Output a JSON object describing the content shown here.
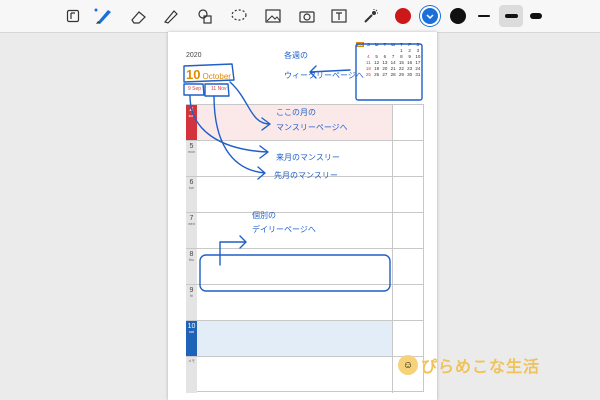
{
  "toolbar": {
    "tools": [
      {
        "name": "page-nav-icon"
      },
      {
        "name": "pen-icon"
      },
      {
        "name": "eraser-icon"
      },
      {
        "name": "highlighter-icon"
      },
      {
        "name": "shapes-icon"
      },
      {
        "name": "lasso-icon"
      },
      {
        "name": "image-icon"
      },
      {
        "name": "camera-icon"
      },
      {
        "name": "text-icon"
      },
      {
        "name": "laser-pointer-icon"
      }
    ],
    "colors": [
      "#cc1818",
      "#1a6fd8",
      "#111111"
    ],
    "selected_color": "#1a6fd8",
    "stroke_widths": [
      "thin",
      "medium",
      "thick"
    ],
    "selected_stroke": "medium"
  },
  "planner": {
    "year": "2020",
    "day": "10",
    "month": "October",
    "prev_tab": "9 Sep",
    "next_tab": "11 Nov",
    "mini_calendar": {
      "badge": "10",
      "weekdays": [
        "S",
        "M",
        "T",
        "W",
        "T",
        "F",
        "S"
      ],
      "rows": [
        [
          "",
          "",
          "",
          "",
          "1",
          "2",
          "3"
        ],
        [
          "4",
          "5",
          "6",
          "7",
          "8",
          "9",
          "10"
        ],
        [
          "11",
          "12",
          "13",
          "14",
          "15",
          "16",
          "17"
        ],
        [
          "18",
          "19",
          "20",
          "21",
          "22",
          "23",
          "24"
        ],
        [
          "25",
          "26",
          "27",
          "28",
          "29",
          "30",
          "31"
        ]
      ]
    },
    "days": [
      {
        "num": "4",
        "dow": "sun"
      },
      {
        "num": "5",
        "dow": "mon"
      },
      {
        "num": "6",
        "dow": "tue"
      },
      {
        "num": "7",
        "dow": "wed"
      },
      {
        "num": "8",
        "dow": "thu"
      },
      {
        "num": "9",
        "dow": "fri"
      },
      {
        "num": "10",
        "dow": "sat"
      },
      {
        "num": "",
        "dow": "メモ"
      }
    ]
  },
  "annotations": {
    "weekly": "各週の\nウィークリーページへ",
    "monthly_this": "ここの月の\nマンスリーページへ",
    "monthly_next": "来月のマンスリー",
    "monthly_prev": "先月のマンスリー",
    "daily": "個別の\nデイリーページへ"
  },
  "watermark": "ぴらめこな生活"
}
